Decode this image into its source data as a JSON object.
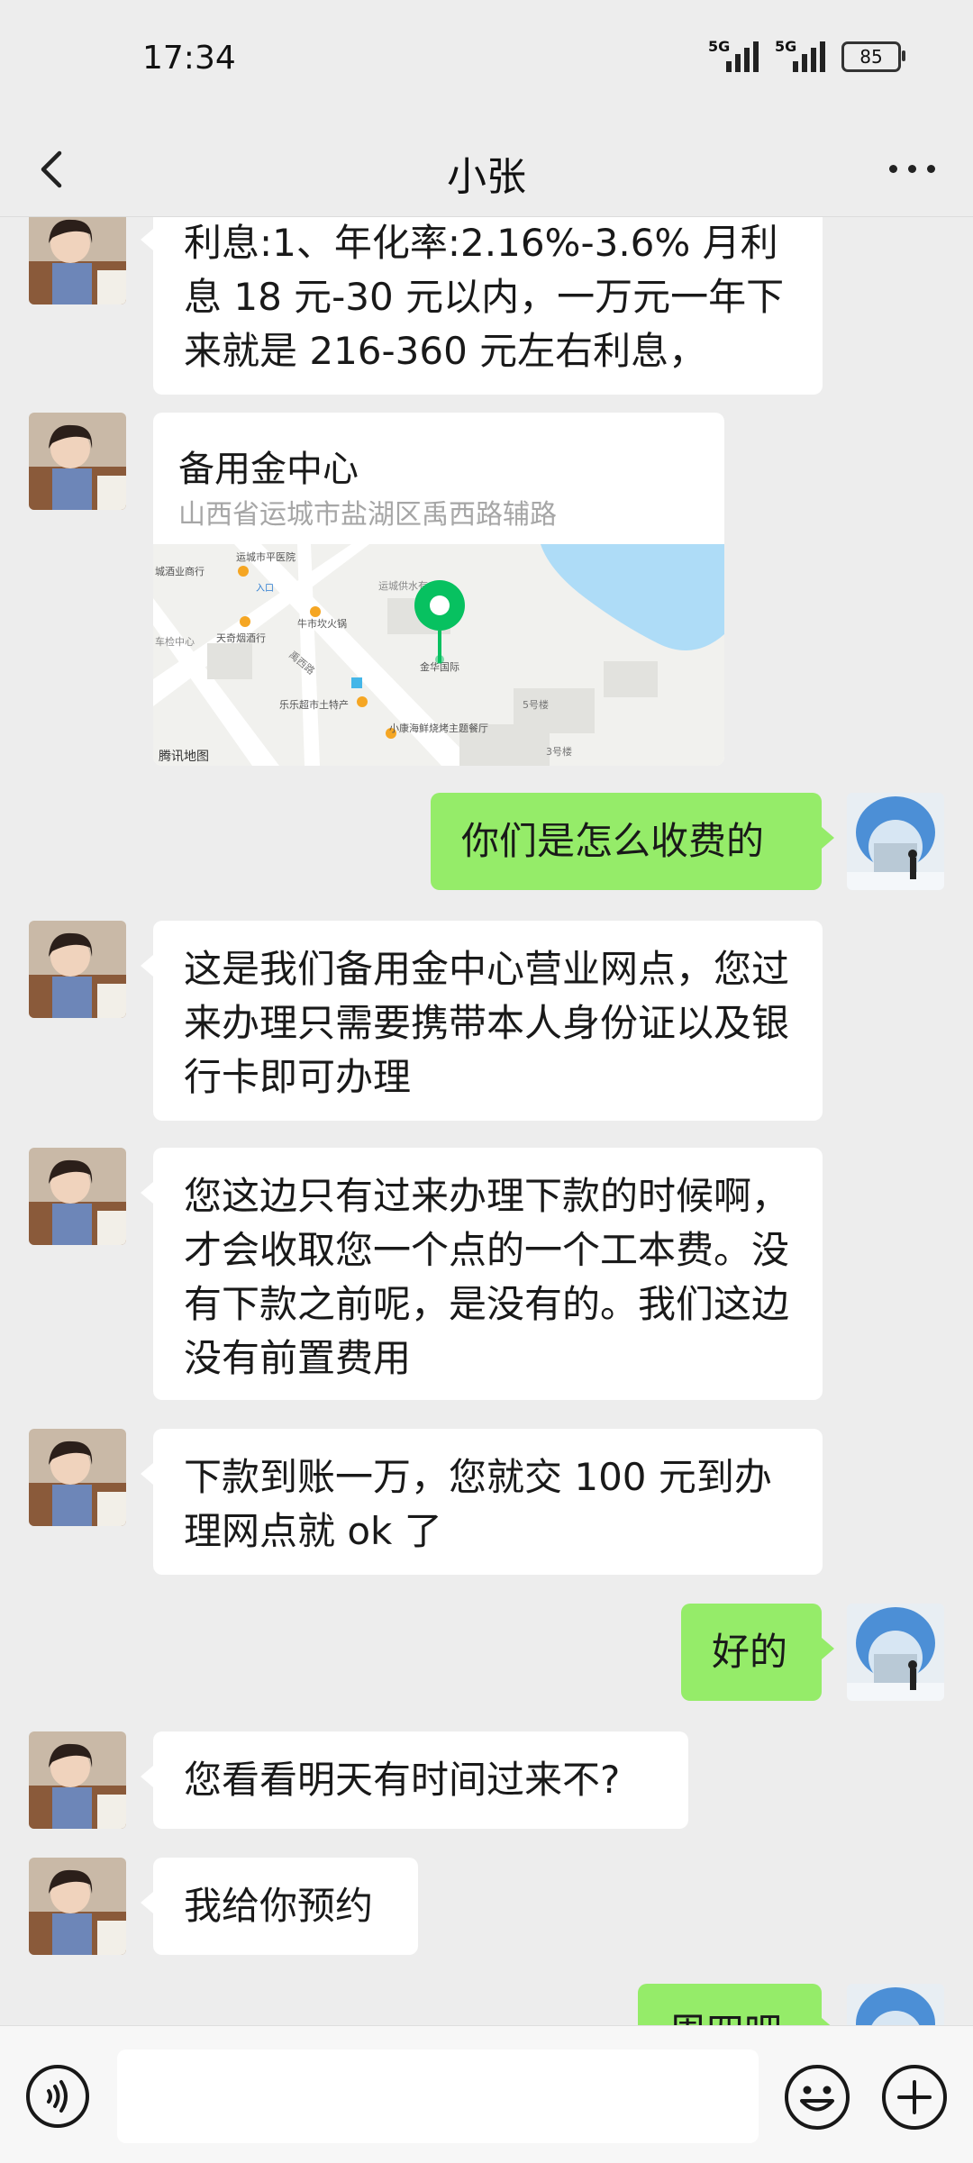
{
  "status_bar": {
    "time": "17:34",
    "signal1_label": "5G",
    "signal2_label": "5G",
    "battery": "85"
  },
  "header": {
    "title": "小张",
    "back_icon": "chevron-left-icon",
    "more_icon": "more-dots-icon"
  },
  "messages": [
    {
      "side": "left",
      "text": "利息:1、年化率:2.16%-3.6% 月利息 18 元-30 元以内，一万元一年下来就是 216-360 元左右利息，"
    },
    {
      "side": "left",
      "type": "location",
      "name": "备用金中心",
      "address": "山西省运城市盐湖区禹西路辅路"
    },
    {
      "side": "right",
      "text": "你们是怎么收费的"
    },
    {
      "side": "left",
      "text": "这是我们备用金中心营业网点，您过来办理只需要携带本人身份证以及银行卡即可办理"
    },
    {
      "side": "left",
      "text": "您这边只有过来办理下款的时候啊，才会收取您一个点的一个工本费。没有下款之前呢，是没有的。我们这边没有前置费用"
    },
    {
      "side": "left",
      "text": "下款到账一万，您就交 100 元到办理网点就 ok 了"
    },
    {
      "side": "right",
      "text": "好的"
    },
    {
      "side": "left",
      "text": "您看看明天有时间过来不?"
    },
    {
      "side": "left",
      "text": "我给你预约"
    },
    {
      "side": "right",
      "text": "周四吧"
    }
  ],
  "map": {
    "labels": {
      "l1": "运城市平医院",
      "l2": "城酒业商行",
      "l3": "牛市坎火锅",
      "l4": "天奇烟酒行",
      "l5": "禹西路",
      "l6": "乐乐超市土特产",
      "l7": "金华国际",
      "l8": "小康海鲜烧烤主题餐厅",
      "l9": "5号楼",
      "l10": "3号楼",
      "l11": "运城供水有",
      "l12": "车检中心",
      "l13": "入口"
    },
    "attribution": "腾讯地图"
  },
  "input_bar": {
    "placeholder": "",
    "voice_icon": "voice-icon",
    "emoji_icon": "emoji-icon",
    "plus_icon": "plus-icon"
  },
  "colors": {
    "background": "#ededed",
    "bubble_left": "#ffffff",
    "bubble_right": "#95ec69",
    "map_pin": "#07c160",
    "map_water": "#aedcf7"
  }
}
